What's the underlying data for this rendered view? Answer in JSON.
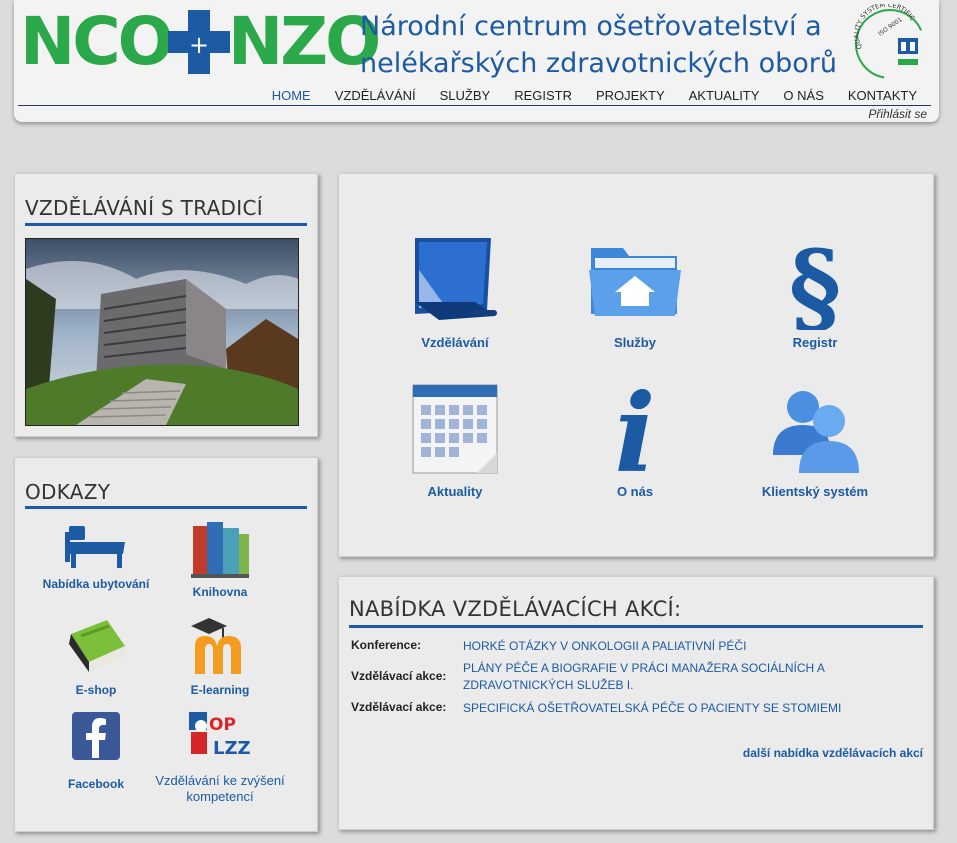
{
  "header": {
    "logo_left": "NCO",
    "logo_plus": "+",
    "logo_right": "NZO",
    "title_line1": "Národní centrum ošetřovatelství a",
    "title_line2": "nelékařských zdravotnických oborů",
    "cert_text": "QUALITY SYSTEM CERTIFICATION",
    "cert_iso": "ISO 9001",
    "nav": [
      "Home",
      "Vzdělávání",
      "Služby",
      "Registr",
      "Projekty",
      "Aktuality",
      "O nás",
      "Kontakty"
    ],
    "login": "Přihlásit se"
  },
  "tradition": {
    "title": "Vzdělávání s tradicí"
  },
  "links": {
    "title": "Odkazy",
    "items": [
      {
        "label": "Nabídka ubytování",
        "icon": "bed-icon"
      },
      {
        "label": "Knihovna",
        "icon": "books-icon"
      },
      {
        "label": "E-shop",
        "icon": "book-icon"
      },
      {
        "label": "E-learning",
        "icon": "moodle-icon"
      },
      {
        "label": "Facebook",
        "icon": "facebook-icon"
      },
      {
        "label": "Vzdělávání ke zvýšení kompetencí",
        "icon": "oplzz-icon"
      }
    ],
    "oplzz_text": "OP LZZ"
  },
  "tiles": [
    {
      "label": "Vzdělávání",
      "icon": "monitor-icon"
    },
    {
      "label": "Služby",
      "icon": "folder-home-icon"
    },
    {
      "label": "Registr",
      "icon": "paragraph-icon",
      "glyph": "§"
    },
    {
      "label": "Aktuality",
      "icon": "calendar-icon"
    },
    {
      "label": "O nás",
      "icon": "info-icon",
      "glyph": "i"
    },
    {
      "label": "Klientský systém",
      "icon": "users-icon"
    }
  ],
  "events": {
    "title": "Nabídka vzdělávacích akcí:",
    "rows": [
      {
        "type": "Konference:",
        "name": "Horké otázky v onkologii a paliativní péči"
      },
      {
        "type": "Vzdělávací akce:",
        "name": "Plány péče a biografie v práci manažera sociálních a zdravotnických služeb I."
      },
      {
        "type": "Vzdělávací akce:",
        "name": "Specifická ošetřovatelská péče o pacienty se stomiemi"
      }
    ],
    "more": "další nabídka vzdělávacích akcí"
  },
  "colors": {
    "brand_green": "#2aa84a",
    "brand_blue": "#1c5aa3"
  }
}
